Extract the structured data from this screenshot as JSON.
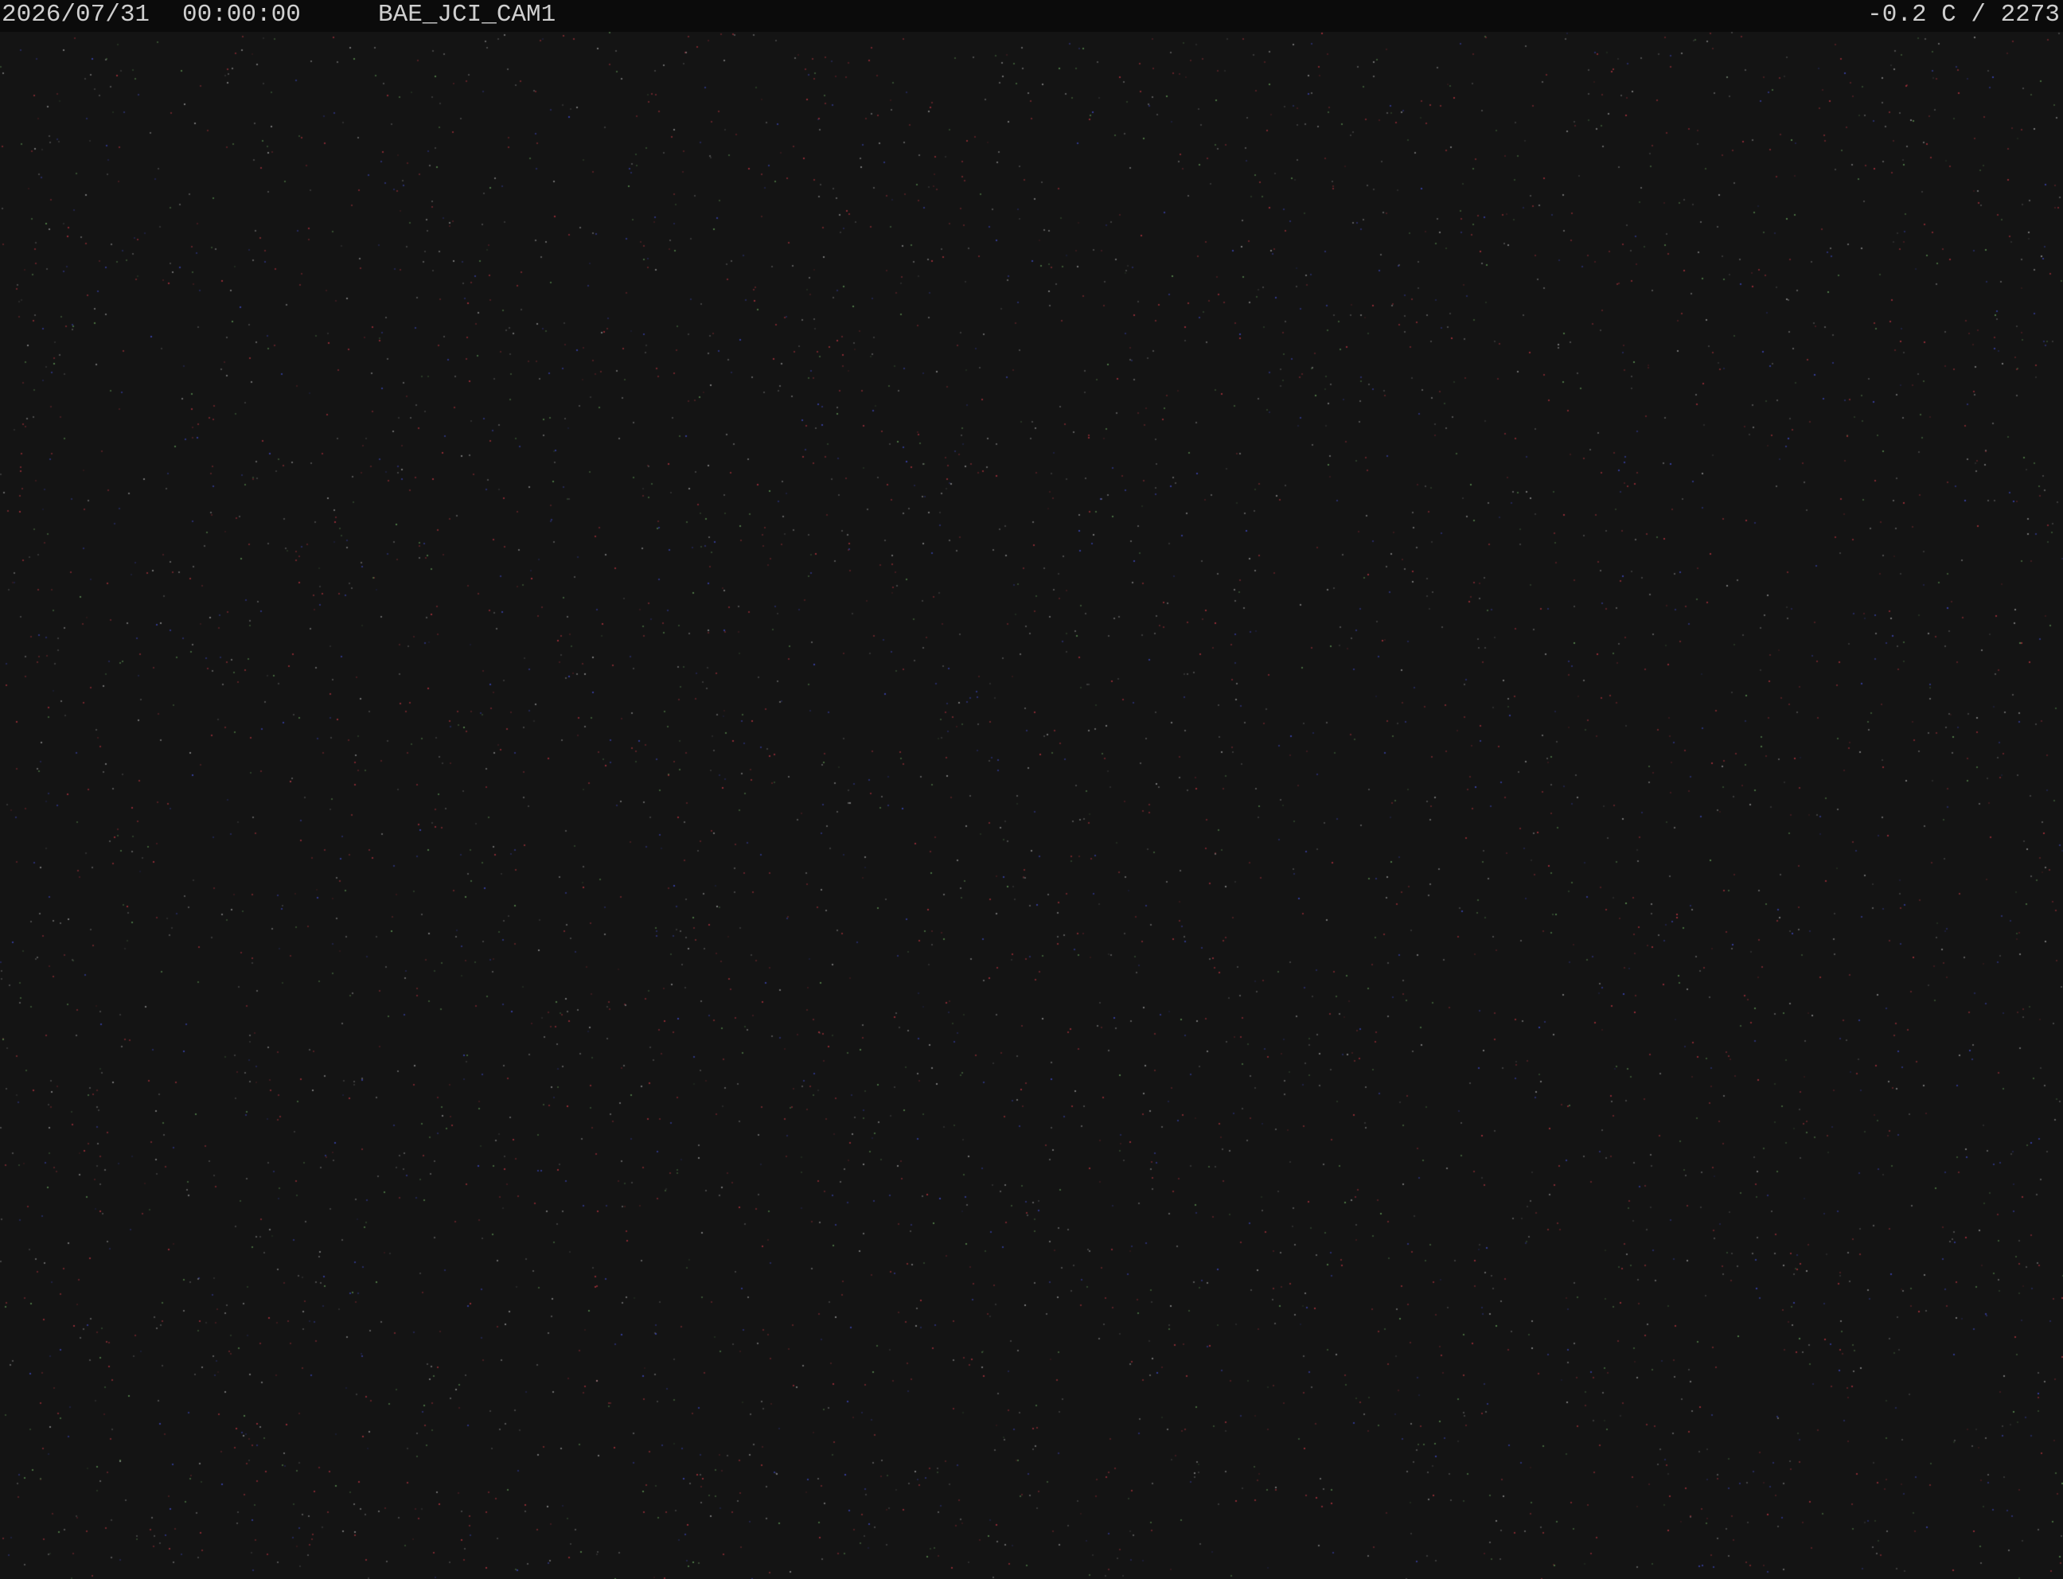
{
  "overlay": {
    "date": "2026/07/31",
    "time": "00:00:00",
    "camera": "BAE_JCI_CAM1",
    "readout": "-0.2 C / 2273"
  },
  "colors": {
    "background": "#141414",
    "overlay_bar": "#0b0b0b",
    "overlay_text": "#cfcfcf",
    "noise_red": "#a8323c",
    "noise_blue": "#3c46b4",
    "noise_green": "#5a8c50",
    "noise_white": "#8c8c8c"
  }
}
